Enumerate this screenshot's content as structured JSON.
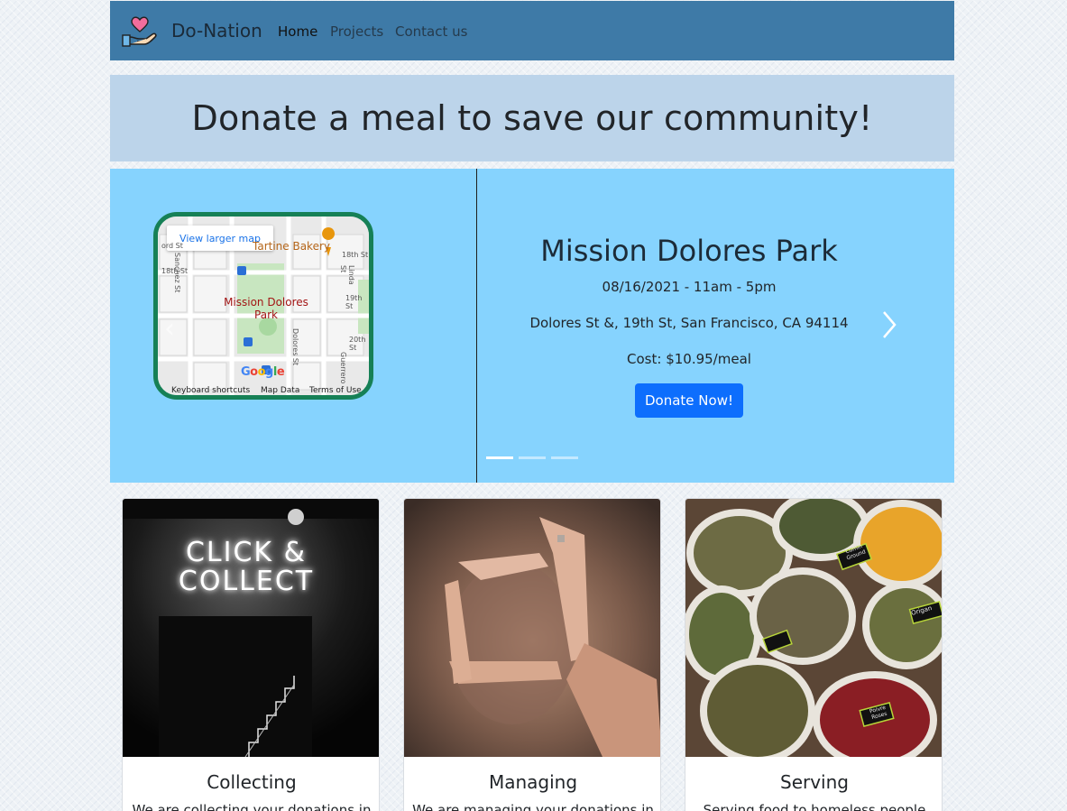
{
  "navbar": {
    "brand": "Do-Nation",
    "logo_icon": "heart-in-hand-icon",
    "links": [
      {
        "label": "Home",
        "active": true
      },
      {
        "label": "Projects",
        "active": false
      },
      {
        "label": "Contact us",
        "active": false
      }
    ]
  },
  "hero": {
    "title": "Donate a meal to save our community!"
  },
  "carousel": {
    "map": {
      "button": "View larger map",
      "place": "Mission Dolores Park",
      "poi": "Tartine Bakery",
      "streets": [
        "Sanchez St",
        "Dolores St",
        "18th St",
        "19th St",
        "20th St",
        "Linda St",
        "Guerrero"
      ],
      "map_footer": [
        "Keyboard shortcuts",
        "Map Data",
        "Terms of Use"
      ],
      "logo": "Google"
    },
    "event": {
      "title": "Mission Dolores Park",
      "datetime": "08/16/2021 - 11am - 5pm",
      "address": "Dolores St &, 19th St, San Francisco, CA 94114",
      "cost": "Cost: $10.95/meal",
      "button": "Donate Now!"
    },
    "active_slide": 1,
    "slide_count": 3,
    "colors": {
      "background": "#86d3fe",
      "button": "#0d6efd"
    }
  },
  "cards": [
    {
      "title": "Collecting",
      "text": "We are collecting your donations in",
      "image_text": [
        "CLICK &",
        "COLLECT"
      ]
    },
    {
      "title": "Managing",
      "text": "We are managing your donations in"
    },
    {
      "title": "Serving",
      "text": "Serving food to homeless people",
      "image_labels": [
        "Cumin Ground",
        "Origan",
        "Poivre Roses"
      ]
    }
  ],
  "colors": {
    "navbar": "#3e7aa7",
    "hero": "#bcd4ea",
    "map_border": "#168056"
  }
}
